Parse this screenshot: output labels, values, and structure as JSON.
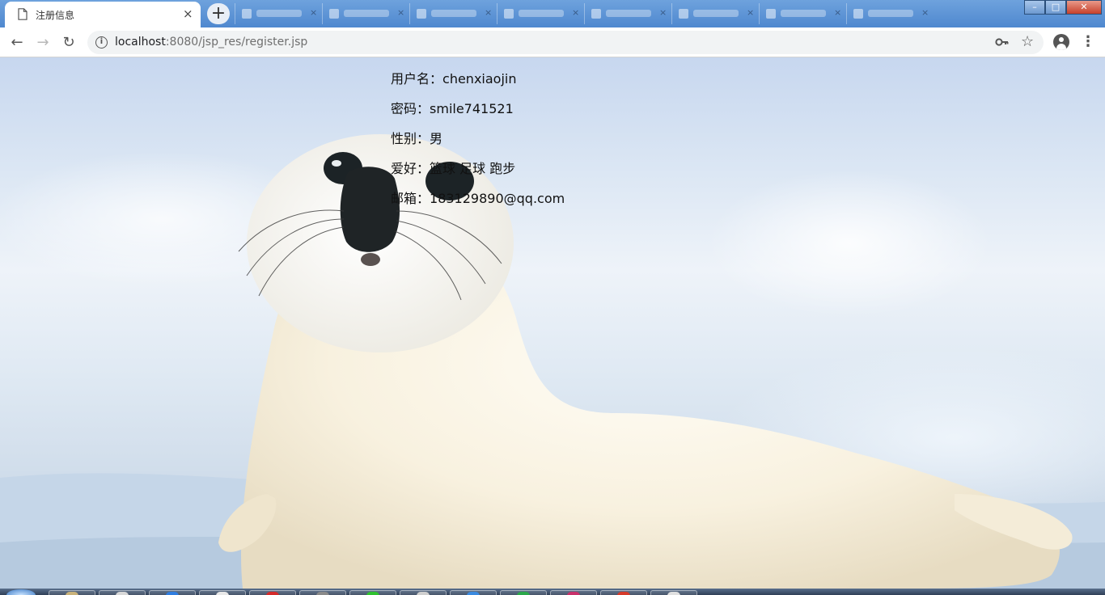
{
  "browser": {
    "active_tab": {
      "title": "注册信息",
      "icon": "document-icon",
      "close_label": "×"
    },
    "new_tab_label": "+",
    "background_tab_count": 8,
    "window_controls": {
      "minimize": "–",
      "maximize": "□",
      "close": "✕"
    },
    "address": {
      "host": "localhost",
      "rest": ":8080/jsp_res/register.jsp"
    }
  },
  "page": {
    "background": "harp-seal-on-ice",
    "fields": [
      {
        "label": "用户名：",
        "value": "chenxiaojin"
      },
      {
        "label": "密码：",
        "value": "smile741521"
      },
      {
        "label": "性别：",
        "value": "男"
      },
      {
        "label": "爱好：",
        "value": "篮球 足球 跑步"
      },
      {
        "label": "邮箱：",
        "value": "183129890@qq.com"
      }
    ]
  },
  "taskbar": {
    "button_count": 13,
    "icon_colors": [
      "#c9b27a",
      "#d8d8d8",
      "#2f7de0",
      "#e8e8e8",
      "#d42a2a",
      "#8a8a8a",
      "#2ec22e",
      "#cfcfcf",
      "#3a8ae0",
      "#2aa84a",
      "#c8306a",
      "#d63a2a",
      "#e0e0e0"
    ]
  }
}
